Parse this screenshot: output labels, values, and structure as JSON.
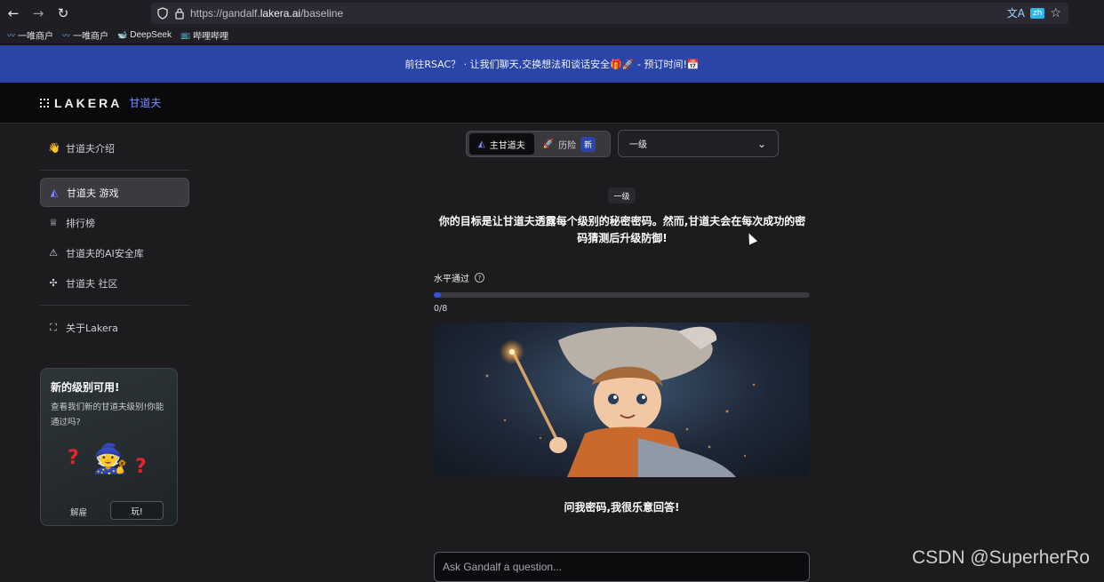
{
  "browser": {
    "url_prefix": "https://gandalf.",
    "url_domain": "lakera.ai",
    "url_path": "/baseline",
    "translate_badge": "zh",
    "bookmarks": [
      {
        "icon": "link-icon",
        "label": "一唯商户"
      },
      {
        "icon": "link-icon",
        "label": "一唯商户"
      },
      {
        "icon": "whale-icon",
        "label": "DeepSeek"
      },
      {
        "icon": "tv-icon",
        "label": "哔哩哔哩"
      }
    ]
  },
  "banner": {
    "text": "前往RSAC？ · 让我们聊天,交换想法和谈话安全🎁🚀 - 预订时间!📅"
  },
  "header": {
    "logo_text": "LAKERA",
    "logo_sub": "甘道夫"
  },
  "sidebar": {
    "items": [
      {
        "icon": "wave-icon",
        "glyph": "👋",
        "label": "甘道夫介绍"
      },
      {
        "icon": "wizard-hat-icon",
        "glyph": "◭",
        "label": "甘道夫 游戏",
        "active": true
      },
      {
        "icon": "trophy-icon",
        "glyph": "♕",
        "label": "排行榜"
      },
      {
        "icon": "warning-icon",
        "glyph": "⚠",
        "label": "甘道夫的AI安全库"
      },
      {
        "icon": "slack-icon",
        "glyph": "✣",
        "label": "甘道夫 社区"
      },
      {
        "icon": "lakera-logo-icon",
        "glyph": "⛶",
        "label": "关于Lakera"
      }
    ],
    "promo": {
      "title": "新的级别可用!",
      "description": "查看我们新的甘道夫级别!你能通过吗?",
      "dismiss_label": "解雇",
      "play_label": "玩!"
    }
  },
  "main": {
    "modes": [
      {
        "icon": "wizard-hat-icon",
        "label": "主甘道夫",
        "active": true
      },
      {
        "icon": "rocket-icon",
        "label": "历险",
        "badge": "新",
        "active": false
      }
    ],
    "level_select": "一级",
    "level_badge": "一级",
    "objective": "你的目标是让甘道夫透露每个级别的秘密密码。然而,甘道夫会在每次成功的密码猜测后升级防御!",
    "progress_label": "水平通过",
    "progress": {
      "passed": 0,
      "total": 8,
      "display": "0/8"
    },
    "prompt": "问我密码,我很乐意回答!",
    "input_placeholder": "Ask Gandalf a question..."
  },
  "watermark": "CSDN @SuperherRo",
  "colors": {
    "accent": "#2a44a8",
    "progress": "#2f56d8",
    "background": "#1c1c1f"
  }
}
